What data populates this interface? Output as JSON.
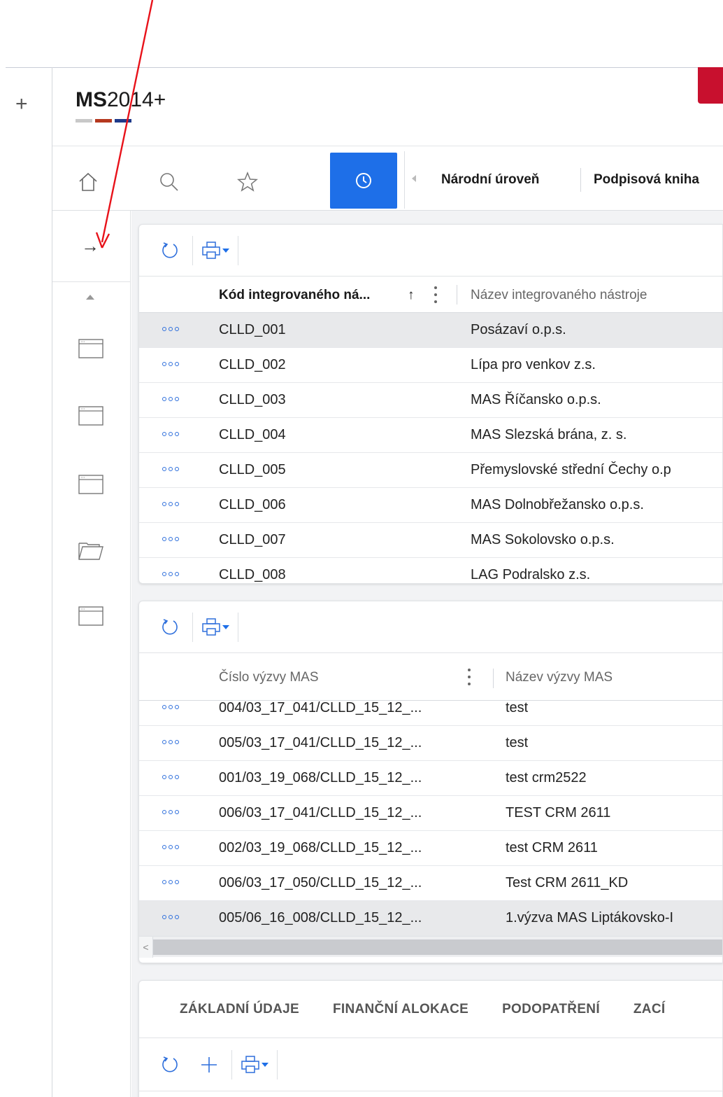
{
  "header": {
    "logo_prefix": "MS",
    "logo_suffix": "2014+",
    "logo_colors": [
      "#c8c8c8",
      "#b5381f",
      "#1f3a8a"
    ],
    "accent_color": "#c8102e"
  },
  "toolbar": {
    "icons": [
      "home-icon",
      "search-icon",
      "star-icon",
      "history-icon"
    ],
    "history_active_color": "#1e6fe8",
    "breadcrumbs": [
      "Národní úroveň",
      "Podpisová kniha"
    ]
  },
  "rail": {
    "expand_icon": "arrow-right-icon",
    "items": [
      "window-icon",
      "window-icon",
      "window-icon",
      "folder-icon",
      "window-icon"
    ]
  },
  "panel1": {
    "columns": [
      "Kód integrovaného ná...",
      "Název integrovaného nástroje"
    ],
    "sort_indicator": "↑",
    "rows": [
      {
        "code": "CLLD_001",
        "name": "Posázaví o.p.s."
      },
      {
        "code": "CLLD_002",
        "name": "Lípa pro venkov z.s."
      },
      {
        "code": "CLLD_003",
        "name": "MAS Říčansko o.p.s."
      },
      {
        "code": "CLLD_004",
        "name": "MAS Slezská brána, z. s."
      },
      {
        "code": "CLLD_005",
        "name": "Přemyslovské střední Čechy o.p"
      },
      {
        "code": "CLLD_006",
        "name": "MAS Dolnobřežansko o.p.s."
      },
      {
        "code": "CLLD_007",
        "name": "MAS Sokolovsko o.p.s."
      },
      {
        "code": "CLLD_008",
        "name": "LAG Podralsko z.s."
      }
    ],
    "selected_row": 0
  },
  "panel2": {
    "columns": [
      "Číslo výzvy MAS",
      "Název výzvy MAS"
    ],
    "rows": [
      {
        "code": "004/03_17_041/CLLD_15_12_...",
        "name": "test"
      },
      {
        "code": "005/03_17_041/CLLD_15_12_...",
        "name": "test"
      },
      {
        "code": "001/03_19_068/CLLD_15_12_...",
        "name": "test crm2522"
      },
      {
        "code": "006/03_17_041/CLLD_15_12_...",
        "name": "TEST CRM 2611"
      },
      {
        "code": "002/03_19_068/CLLD_15_12_...",
        "name": "test CRM 2611"
      },
      {
        "code": "006/03_17_050/CLLD_15_12_...",
        "name": "Test CRM 2611_KD"
      },
      {
        "code": "005/06_16_008/CLLD_15_12_...",
        "name": "1.výzva MAS Liptákovsko-I"
      }
    ],
    "selected_row": 6
  },
  "panel3": {
    "tabs": [
      "ZÁKLADNÍ ÚDAJE",
      "FINANČNÍ ALOKACE",
      "PODOPATŘENÍ",
      "ZACÍ"
    ]
  },
  "annotation": {
    "arrow_color": "#e8121a"
  }
}
